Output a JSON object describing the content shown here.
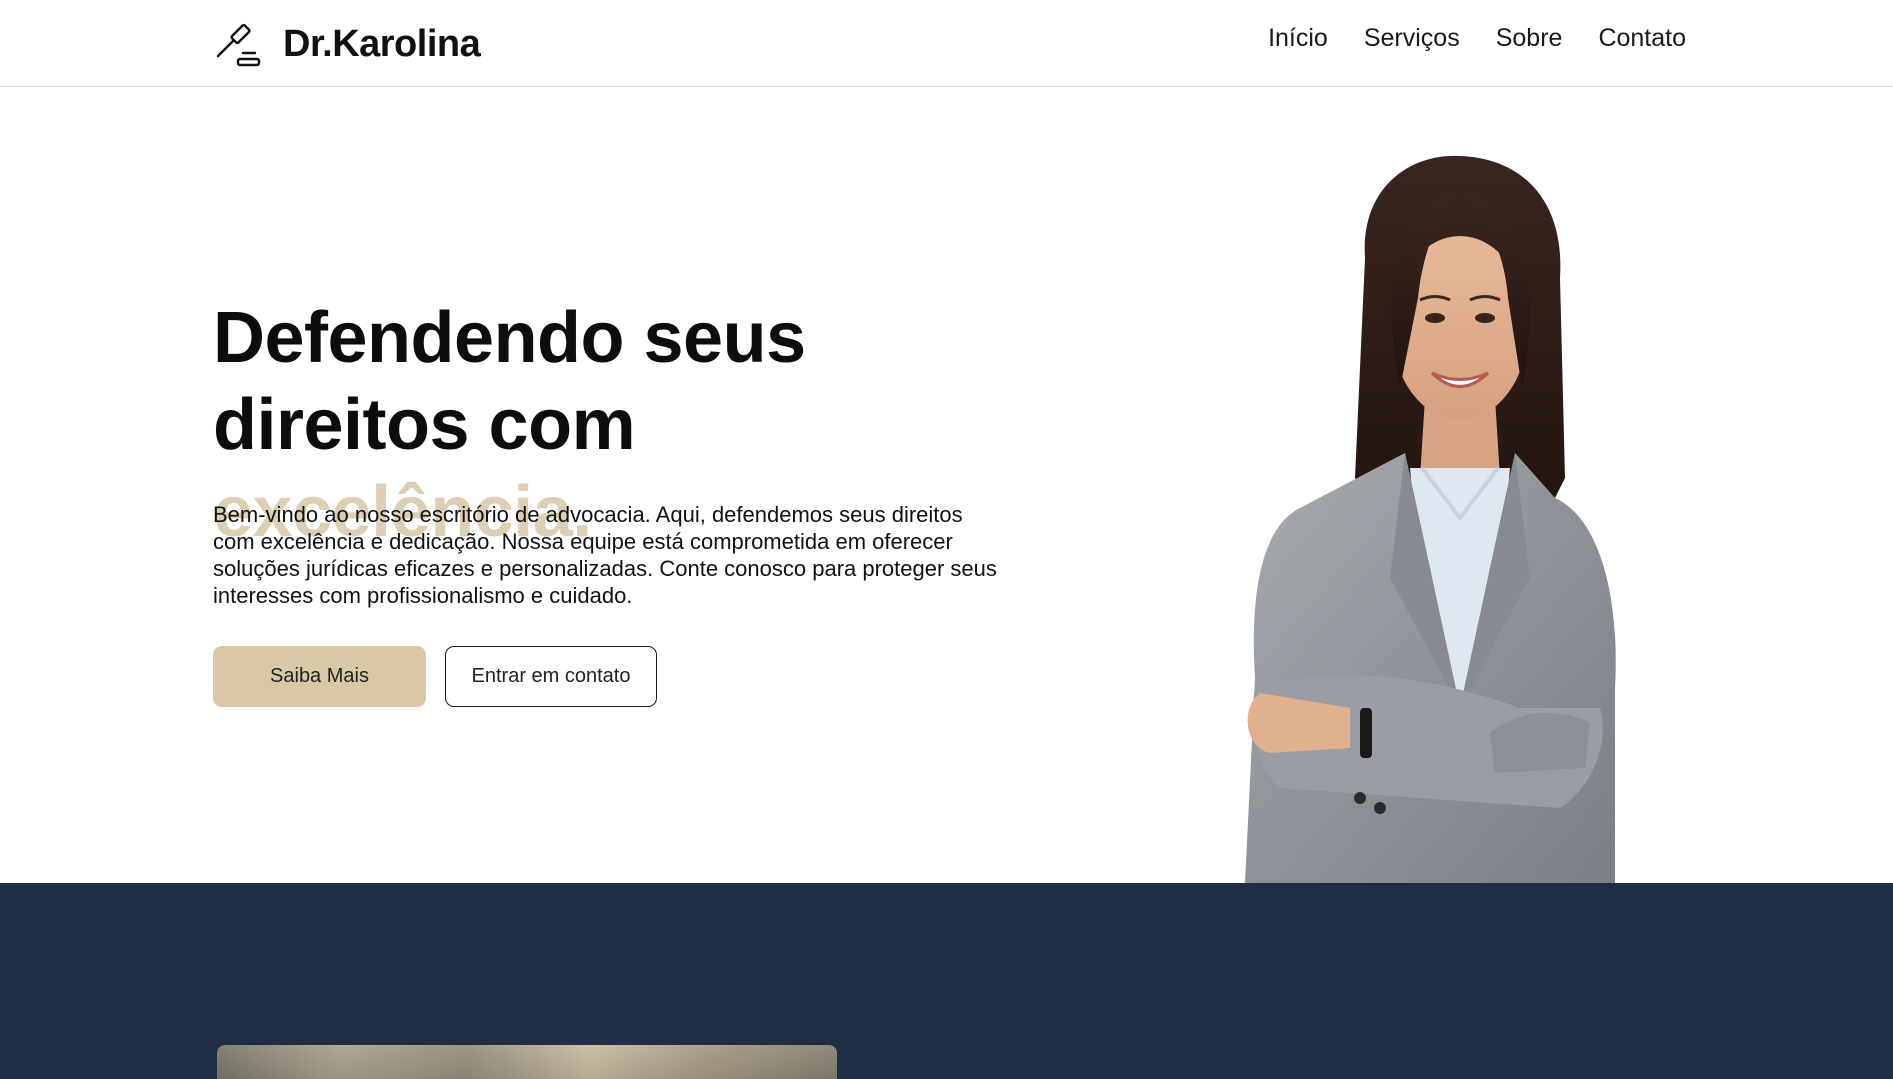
{
  "header": {
    "logo_icon": "gavel-icon",
    "brand": "Dr.Karolina",
    "nav": [
      {
        "label": "Início"
      },
      {
        "label": "Serviços"
      },
      {
        "label": "Sobre"
      },
      {
        "label": "Contato"
      }
    ]
  },
  "hero": {
    "title_part1": "Defendendo seus direitos com ",
    "title_accent": "excelência.",
    "description": "Bem-vindo ao nosso escritório de advocacia. Aqui, defendemos seus direitos com excelência e dedicação. Nossa equipe está comprometida em oferecer soluções jurídicas eficazes e personalizadas. Conte conosco para proteger seus interesses com profissionalismo e cuidado.",
    "primary_button": "Saiba Mais",
    "secondary_button": "Entrar em contato"
  },
  "colors": {
    "accent": "#ddcfb3",
    "primary_button_bg": "#d9c8a6",
    "dark_section_bg": "#1f2d45",
    "header_border": "#e3dccd"
  }
}
